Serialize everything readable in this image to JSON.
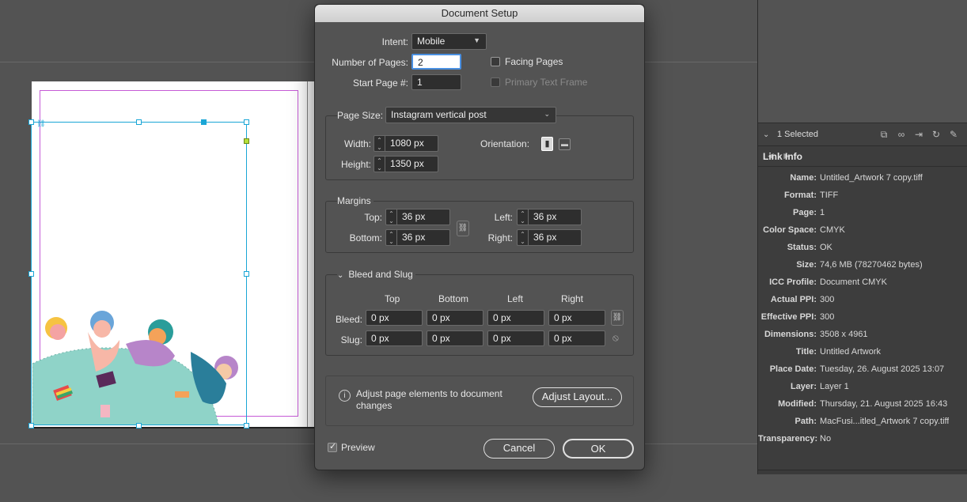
{
  "dialog": {
    "title": "Document Setup",
    "intent_label": "Intent:",
    "intent_value": "Mobile",
    "num_pages_label": "Number of Pages:",
    "num_pages_value": "2",
    "start_page_label": "Start Page #:",
    "start_page_value": "1",
    "facing_pages_label": "Facing Pages",
    "primary_text_frame_label": "Primary Text Frame",
    "page_size_label": "Page Size:",
    "page_size_value": "Instagram vertical post",
    "width_label": "Width:",
    "width_value": "1080 px",
    "height_label": "Height:",
    "height_value": "1350 px",
    "orientation_label": "Orientation:",
    "margins_label": "Margins",
    "top_label": "Top:",
    "top_value": "36 px",
    "bottom_label": "Bottom:",
    "bottom_value": "36 px",
    "left_label": "Left:",
    "left_value": "36 px",
    "right_label": "Right:",
    "right_value": "36 px",
    "bleed_slug_label": "Bleed and Slug",
    "col_top": "Top",
    "col_bottom": "Bottom",
    "col_left": "Left",
    "col_right": "Right",
    "bleed_label": "Bleed:",
    "slug_label": "Slug:",
    "bleed_values": [
      "0 px",
      "0 px",
      "0 px",
      "0 px"
    ],
    "slug_values": [
      "0 px",
      "0 px",
      "0 px",
      "0 px"
    ],
    "adjust_text_line1": "Adjust page elements to document",
    "adjust_text_line2": "changes",
    "adjust_button": "Adjust Layout...",
    "preview_label": "Preview",
    "cancel_button": "Cancel",
    "ok_button": "OK"
  },
  "links_panel": {
    "selected_text": "1 Selected",
    "link_info_label": "Link Info",
    "rows": [
      {
        "key": "Name:",
        "value": "Untitled_Artwork 7 copy.tiff"
      },
      {
        "key": "Format:",
        "value": "TIFF"
      },
      {
        "key": "Page:",
        "value": "1"
      },
      {
        "key": "Color Space:",
        "value": "CMYK"
      },
      {
        "key": "Status:",
        "value": "OK"
      },
      {
        "key": "Size:",
        "value": "74,6 MB (78270462 bytes)"
      },
      {
        "key": "ICC Profile:",
        "value": "Document CMYK"
      },
      {
        "key": "Actual PPI:",
        "value": "300"
      },
      {
        "key": "Effective PPI:",
        "value": "300"
      },
      {
        "key": "Dimensions:",
        "value": "3508 x 4961"
      },
      {
        "key": "Title:",
        "value": "Untitled Artwork"
      },
      {
        "key": "Place Date:",
        "value": "Tuesday, 26. August 2025 13:07"
      },
      {
        "key": "Layer:",
        "value": "Layer 1"
      },
      {
        "key": "Modified:",
        "value": "Thursday, 21. August 2025 16:43"
      },
      {
        "key": "Path:",
        "value": "MacFusi...itled_Artwork 7 copy.tiff"
      },
      {
        "key": "Transparency:",
        "value": "No"
      }
    ]
  },
  "colors": {
    "accent": "#1aa6d6",
    "margin_guide": "#c55bd6",
    "dialog_bg": "#535353"
  }
}
